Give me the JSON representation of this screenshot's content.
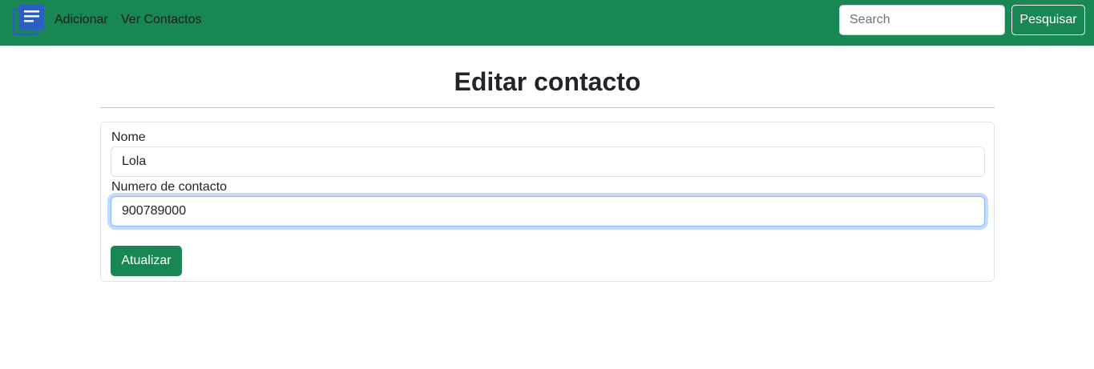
{
  "navbar": {
    "logo_icon": "document-list-icon",
    "links": [
      {
        "label": "Adicionar"
      },
      {
        "label": "Ver Contactos"
      }
    ],
    "search": {
      "placeholder": "Search",
      "value": ""
    },
    "search_button": "Pesquisar",
    "background_color": "#198754"
  },
  "page": {
    "title": "Editar contacto"
  },
  "form": {
    "name_label": "Nome",
    "name_value": "Lola",
    "number_label": "Numero de contacto",
    "number_value": "900789000",
    "submit_label": "Atualizar"
  }
}
